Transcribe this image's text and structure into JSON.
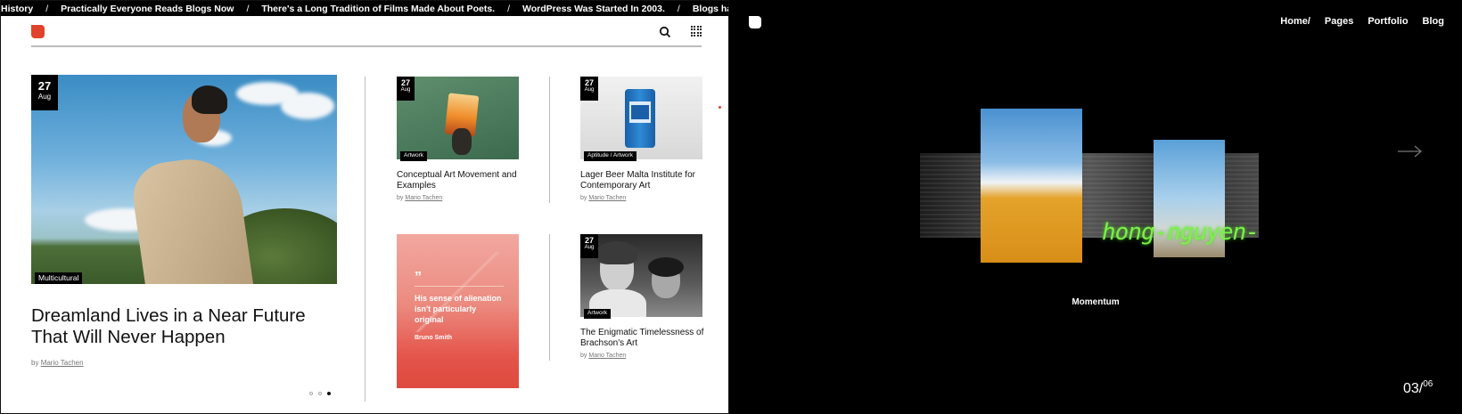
{
  "ticker": {
    "items": [
      "History",
      "Practically Everyone Reads Blogs Now",
      "There's a Long Tradition of Films Made About Poets.",
      "WordPress Was Started In 2003.",
      "Blogs have a relatively short his"
    ],
    "separator": "/"
  },
  "left_panel": {
    "accent_color": "#e0432b",
    "featured": {
      "day": "27",
      "month": "Aug",
      "category": "Multicultural",
      "title": "Dreamland Lives in a Near Future That Will Never Happen",
      "by": "by",
      "author": "Mario Tachen"
    },
    "cards": [
      {
        "day": "27",
        "month": "Aug",
        "category": "Artwork",
        "title": "Conceptual Art Movement and Examples",
        "by": "by",
        "author": "Mario Tachen"
      },
      {
        "day": "27",
        "month": "Aug",
        "category": "Aptitude / Artwork",
        "title": "Lager Beer Malta Institute for Contemporary Art",
        "by": "by",
        "author": "Mario Tachen"
      },
      {
        "quote_mark": "”",
        "quote": "His sense of alienation isn't particularly original",
        "quote_author": "Bruno Smith"
      },
      {
        "day": "27",
        "month": "Aug",
        "category": "Artwork",
        "title": "The Enigmatic Timelessness of Brachson's Art",
        "by": "by",
        "author": "Mario Tachen"
      }
    ],
    "pagination": {
      "total": 3,
      "active": 3
    }
  },
  "right_panel": {
    "nav": [
      "Home/",
      "Pages",
      "Portfolio",
      "Blog"
    ],
    "neon_text": "hong-nguyen-",
    "caption": "Momentum",
    "counter": {
      "current": "03",
      "sep": "/",
      "total": "06"
    },
    "neon_color": "#7cf04a"
  }
}
